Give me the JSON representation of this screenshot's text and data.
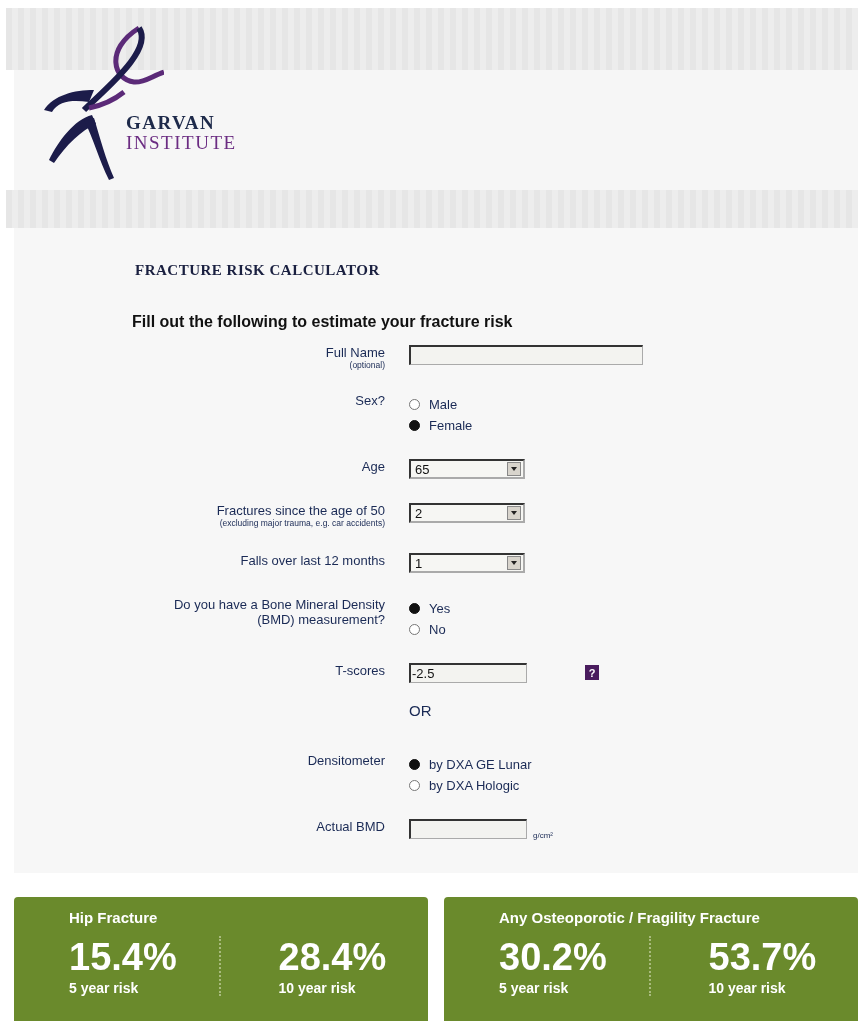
{
  "header": {
    "logo_line_1": "GARVAN",
    "logo_line_2": "INSTITUTE"
  },
  "page_title": "FRACTURE RISK CALCULATOR",
  "form": {
    "heading": "Fill out the following to estimate your fracture risk",
    "rows": [
      {
        "kind": "text",
        "label": "Full Name",
        "sublabel": "(optional)"
      },
      {
        "kind": "radio",
        "label": "Sex?",
        "options": [
          {
            "label": "Male",
            "selected": false
          },
          {
            "label": "Female",
            "selected": true
          }
        ]
      },
      {
        "kind": "select",
        "label": "Age",
        "value": "65"
      },
      {
        "kind": "select",
        "label": "Fractures since the age of 50",
        "sublabel": "(excluding major trauma, e.g. car accidents)",
        "value": "2"
      },
      {
        "kind": "select",
        "label": "Falls over last 12 months",
        "value": "1"
      },
      {
        "kind": "radio",
        "label": "Do you have a Bone Mineral Density (BMD) measurement?",
        "options": [
          {
            "label": "Yes",
            "selected": true
          },
          {
            "label": "No",
            "selected": false
          }
        ]
      },
      {
        "kind": "text",
        "label": "T-scores",
        "value": "-2.5",
        "help": "?"
      },
      {
        "kind": "or",
        "text": "OR"
      },
      {
        "kind": "radio",
        "label": "Densitometer",
        "options": [
          {
            "label": "by DXA GE Lunar",
            "selected": true
          },
          {
            "label": "by DXA Hologic",
            "selected": false
          }
        ]
      },
      {
        "kind": "text",
        "label": "Actual BMD",
        "unit": "g/cm²"
      }
    ]
  },
  "results": [
    {
      "title": "Hip Fracture",
      "risks": [
        {
          "value": "15.4%",
          "label": "5 year risk"
        },
        {
          "value": "28.4%",
          "label": "10 year risk"
        }
      ]
    },
    {
      "title": "Any Osteoporotic / Fragility Fracture",
      "risks": [
        {
          "value": "30.2%",
          "label": "5 year risk"
        },
        {
          "value": "53.7%",
          "label": "10 year risk"
        }
      ]
    }
  ]
}
